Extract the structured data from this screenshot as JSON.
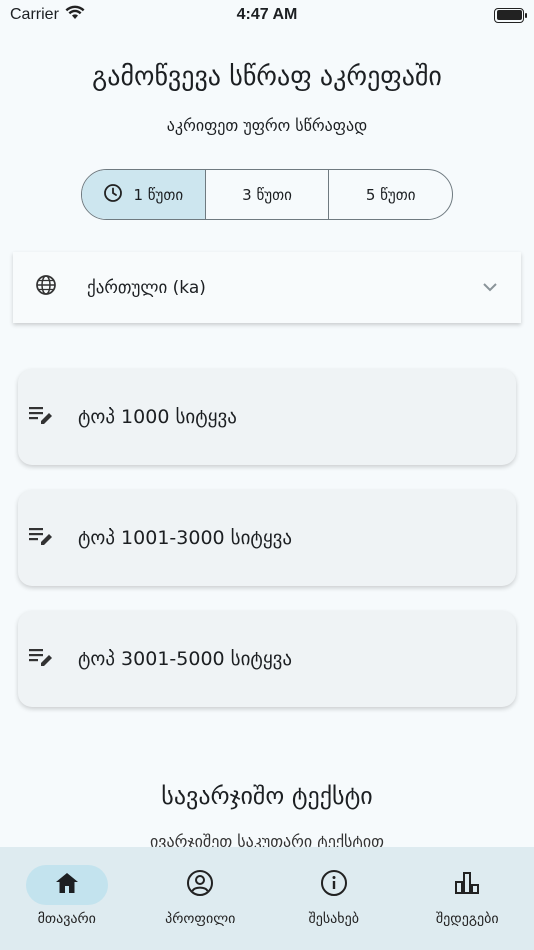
{
  "status_bar": {
    "carrier": "Carrier",
    "time": "4:47 AM"
  },
  "header": {
    "title": "გამოწვევა სწრაფ აკრეფაში",
    "subtitle": "აკრიფეთ უფრო სწრაფად"
  },
  "duration_options": [
    {
      "label": "1 წუთი",
      "selected": true
    },
    {
      "label": "3 წუთი",
      "selected": false
    },
    {
      "label": "5 წუთი",
      "selected": false
    }
  ],
  "language_select": {
    "value": "ქართული (ka)"
  },
  "word_lists": [
    {
      "label": "ტოპ 1000 სიტყვა"
    },
    {
      "label": "ტოპ 1001-3000 სიტყვა"
    },
    {
      "label": "ტოპ 3001-5000 სიტყვა"
    }
  ],
  "custom_text": {
    "title": "სავარჯიშო ტექსტი",
    "subtitle": "ივარჯიშეთ საკუთარი ტექსტით"
  },
  "bottom_nav": [
    {
      "label": "მთავარი",
      "icon": "home-icon",
      "active": true
    },
    {
      "label": "პროფილი",
      "icon": "profile-icon",
      "active": false
    },
    {
      "label": "შესახებ",
      "icon": "info-icon",
      "active": false
    },
    {
      "label": "შედეგები",
      "icon": "chart-icon",
      "active": false
    }
  ],
  "colors": {
    "accent": "#cde6ef",
    "nav_background": "#deebf0",
    "card_background": "#eff3f5"
  }
}
